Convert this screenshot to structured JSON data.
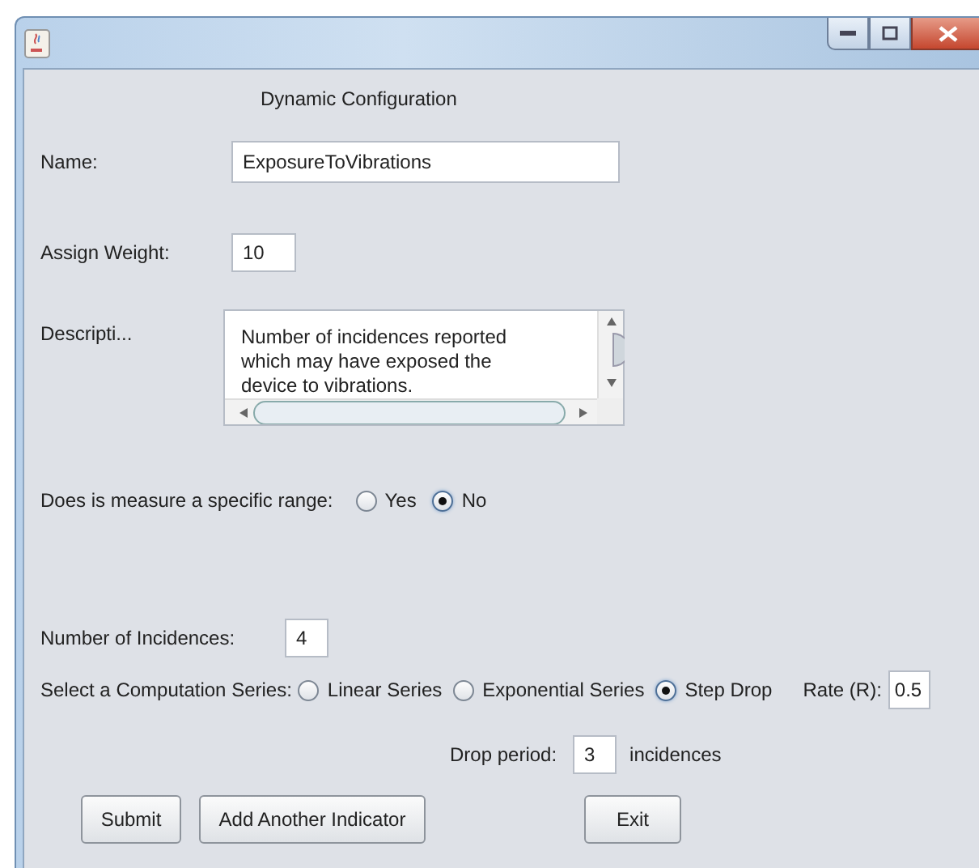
{
  "heading": "Dynamic Configuration",
  "name": {
    "label": "Name:",
    "value": "ExposureToVibrations"
  },
  "weight": {
    "label": "Assign Weight:",
    "value": "10"
  },
  "description": {
    "label": "Descripti...",
    "value": "Number of incidences reported which may have exposed the device to vibrations."
  },
  "range": {
    "label": "Does is measure a specific range:",
    "options": [
      {
        "label": "Yes",
        "selected": false
      },
      {
        "label": "No",
        "selected": true
      }
    ]
  },
  "incidences": {
    "label": "Number of Incidences:",
    "value": "4"
  },
  "series": {
    "label": "Select a Computation Series:",
    "options": [
      {
        "label": "Linear Series",
        "selected": false
      },
      {
        "label": "Exponential Series",
        "selected": false
      },
      {
        "label": "Step Drop",
        "selected": true
      }
    ]
  },
  "rate": {
    "label": "Rate (R):",
    "value": "0.5"
  },
  "drop_period": {
    "label": "Drop period:",
    "value": "3",
    "unit": "incidences"
  },
  "buttons": [
    "Submit",
    "Add Another Indicator",
    "Exit"
  ]
}
